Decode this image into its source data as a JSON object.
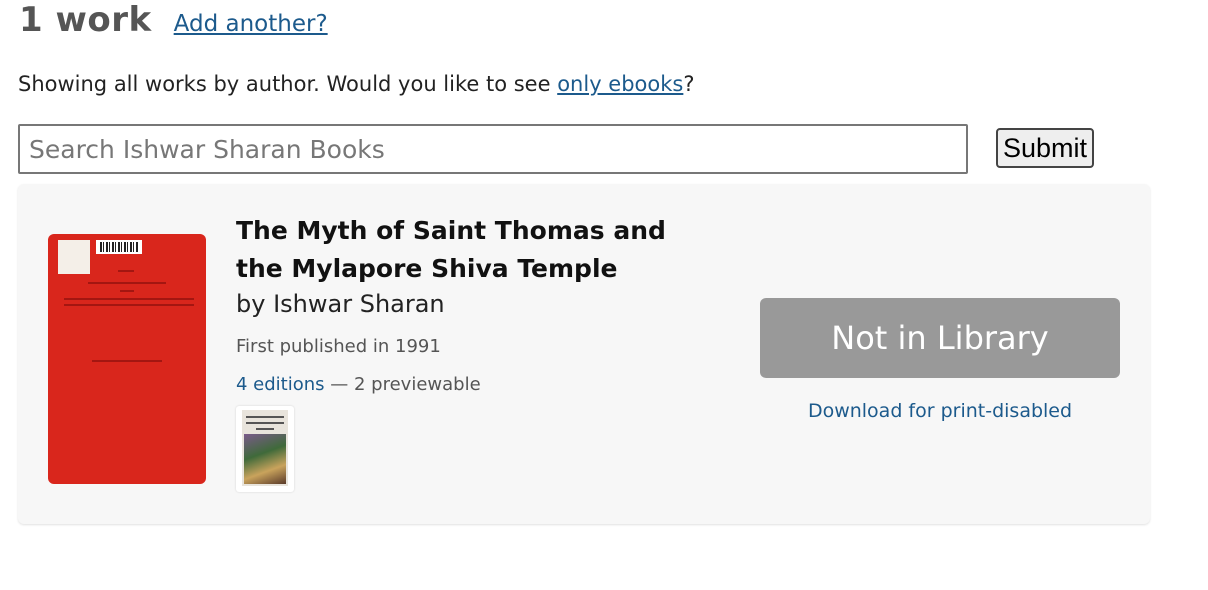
{
  "header": {
    "work_count": "1 work",
    "add_another": "Add another?"
  },
  "notice": {
    "prefix": "Showing all works by author. Would you like to see ",
    "link": "only ebooks",
    "suffix": "?"
  },
  "search": {
    "placeholder": "Search Ishwar Sharan Books",
    "value": "",
    "submit_label": "Submit"
  },
  "result": {
    "title": "The Myth of Saint Thomas and the Mylapore Shiva Temple",
    "by_prefix": "by ",
    "author": "Ishwar Sharan",
    "first_published": "First published in 1991",
    "editions_link": "4 editions",
    "previewable": " — 2 previewable",
    "availability_button": "Not in Library",
    "download_link": "Download for print-disabled"
  },
  "colors": {
    "link": "#1c5a8c",
    "cover_red": "#d9261c",
    "availability_button_bg": "#999999",
    "card_bg": "#f7f7f7"
  },
  "icons": {
    "cover": "book-cover-image",
    "edition_thumbnail": "edition-cover-thumbnail"
  }
}
